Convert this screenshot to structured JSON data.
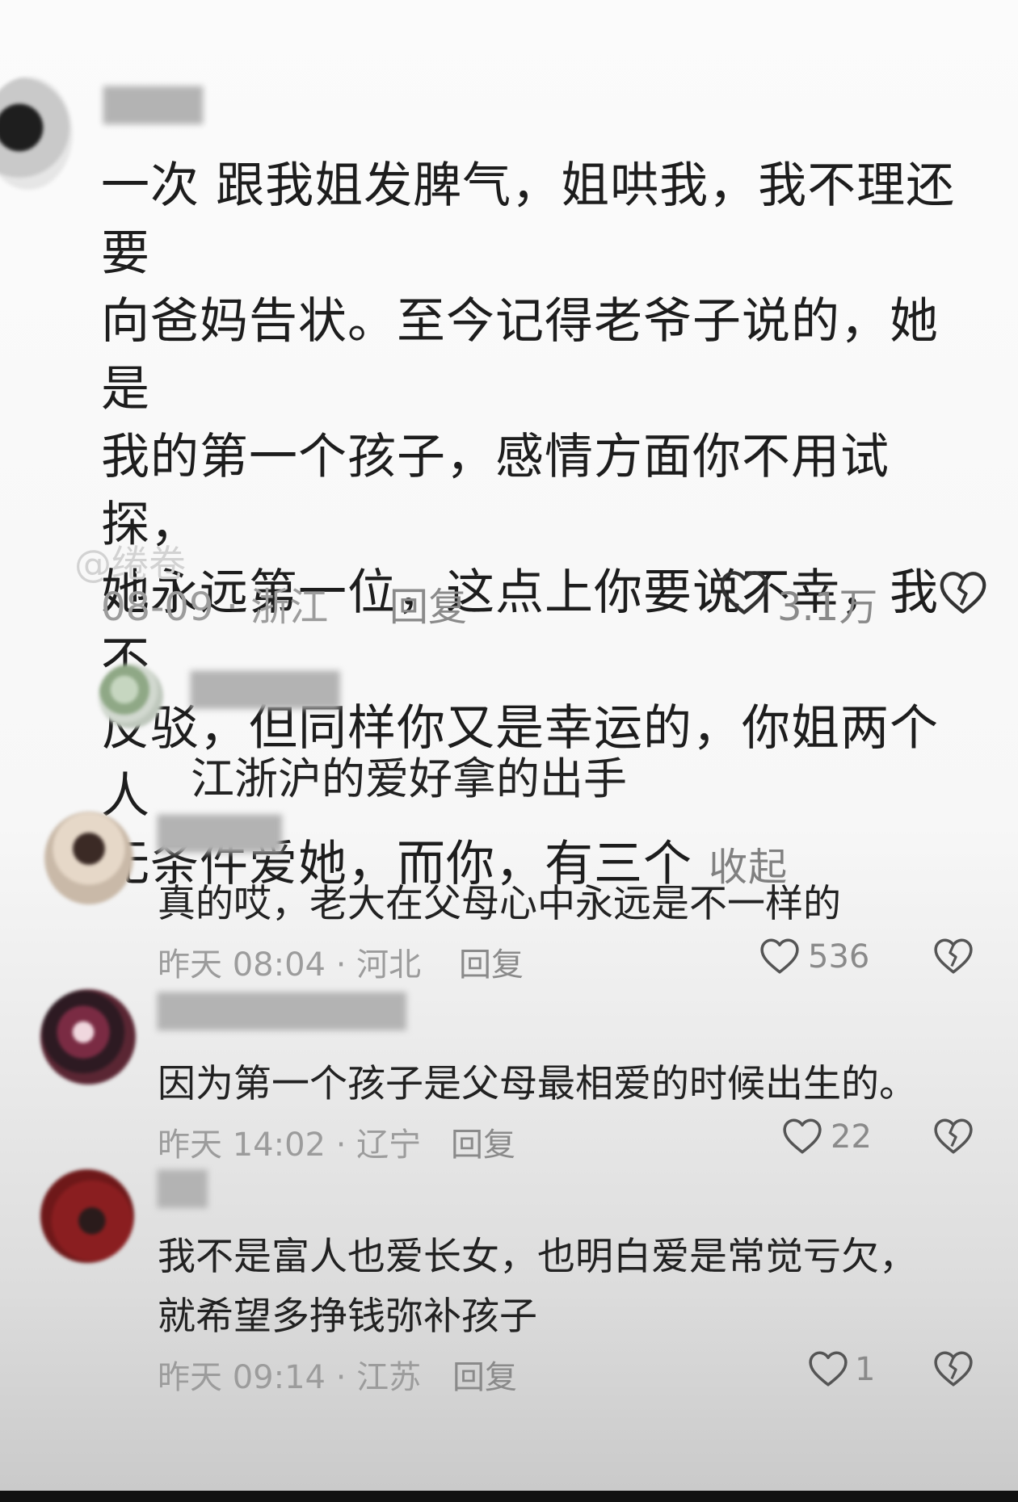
{
  "main_comment": {
    "text": "一次 跟我姐发脾气，姐哄我，我不理还要\n向爸妈告状。至今记得老爷子说的，她是\n我的第一个孩子，感情方面你不用试探，\n她永远第一位，这点上你要说不幸，我不\n反驳，但同样你又是幸运的，你姐两个人\n无条件爱她，而你，有三个 ",
    "collapse_label": "收起",
    "watermark": "@绻卷",
    "date": "08-09",
    "location": "浙江",
    "meta": "08-09 · 浙江",
    "reply_label": "回复",
    "likes": "3.1万"
  },
  "replies": [
    {
      "text": "江浙沪的爱好拿的出手"
    },
    {
      "text": "真的哎，老大在父母心中永远是不一样的",
      "meta": "昨天 08:04 · 河北",
      "reply_label": "回复",
      "likes": "536"
    },
    {
      "text": "因为第一个孩子是父母最相爱的时候出生的。",
      "meta": "昨天 14:02 · 辽宁",
      "reply_label": "回复",
      "likes": "22"
    },
    {
      "text": "我不是富人也爱长女，也明白爱是常觉亏欠，\n就希望多挣钱弥补孩子",
      "meta": "昨天 09:14 · 江苏",
      "reply_label": "回复",
      "likes": "1"
    }
  ],
  "icons": {
    "like": "heart-outline-icon",
    "dislike": "broken-heart-icon"
  }
}
